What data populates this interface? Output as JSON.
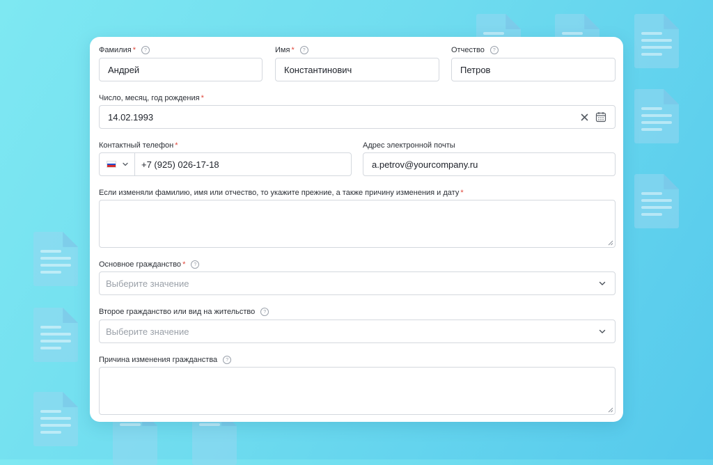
{
  "form": {
    "last_name": {
      "label": "Фамилия",
      "value": "Андрей"
    },
    "first_name": {
      "label": "Имя",
      "value": "Константинович"
    },
    "patronymic": {
      "label": "Отчество",
      "value": "Петров"
    },
    "birth_date": {
      "label": "Число, месяц, год рождения",
      "value": "14.02.1993"
    },
    "phone": {
      "label": "Контактный телефон",
      "value": "+7 (925) 026-17-18",
      "country_icon": "russia-flag-icon"
    },
    "email": {
      "label": "Адрес электронной почты",
      "value": "a.petrov@yourcompany.ru"
    },
    "name_change": {
      "label": "Если изменяли фамилию, имя или отчество, то укажите прежние, а также причину изменения и дату",
      "value": ""
    },
    "citizenship": {
      "label": "Основное гражданство",
      "placeholder": "Выберите значение"
    },
    "second_citizenship": {
      "label": "Второе гражданство или вид на жительство",
      "placeholder": "Выберите значение"
    },
    "citizenship_change_reason": {
      "label": "Причина изменения гражданства",
      "value": ""
    }
  },
  "required_mark": "*",
  "help_glyph": "?",
  "colors": {
    "required": "#e0463a",
    "border": "#d4d8de",
    "background_start": "#7ee8f2",
    "background_end": "#55c9ec"
  }
}
